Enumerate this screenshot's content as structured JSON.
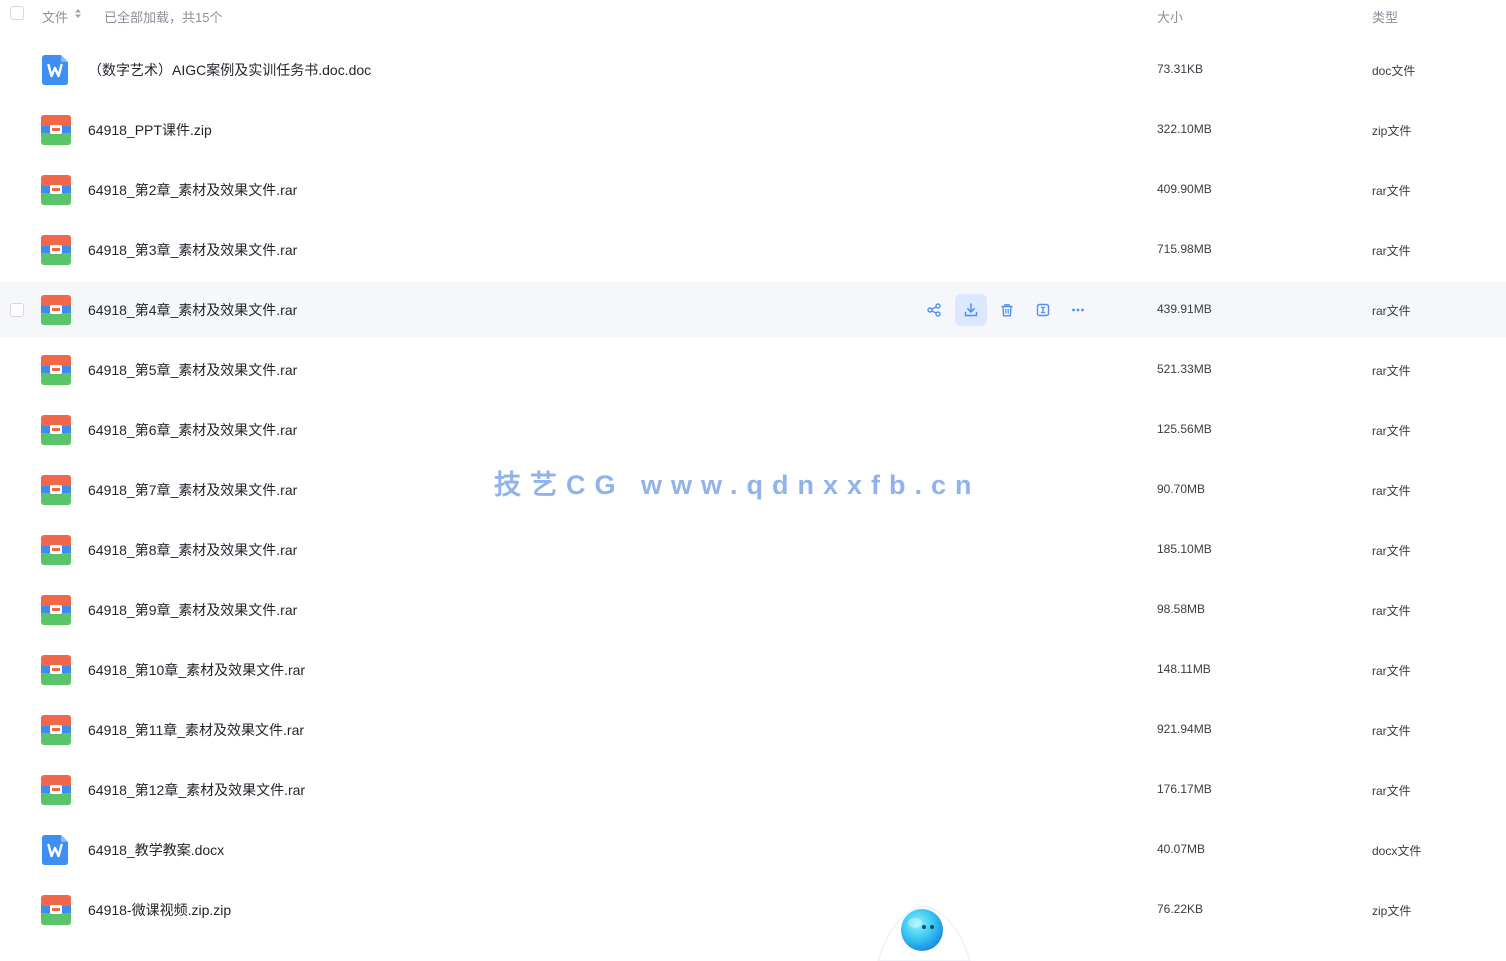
{
  "header": {
    "col_file": "文件",
    "status": "已全部加载，共15个",
    "col_size": "大小",
    "col_type": "类型"
  },
  "files": [
    {
      "name": "（数字艺术）AIGC案例及实训任务书.doc.doc",
      "size": "73.31KB",
      "type": "doc文件",
      "icon": "word-doc-icon"
    },
    {
      "name": "64918_PPT课件.zip",
      "size": "322.10MB",
      "type": "zip文件",
      "icon": "archive-icon"
    },
    {
      "name": "64918_第2章_素材及效果文件.rar",
      "size": "409.90MB",
      "type": "rar文件",
      "icon": "archive-icon"
    },
    {
      "name": "64918_第3章_素材及效果文件.rar",
      "size": "715.98MB",
      "type": "rar文件",
      "icon": "archive-icon"
    },
    {
      "name": "64918_第4章_素材及效果文件.rar",
      "size": "439.91MB",
      "type": "rar文件",
      "icon": "archive-icon"
    },
    {
      "name": "64918_第5章_素材及效果文件.rar",
      "size": "521.33MB",
      "type": "rar文件",
      "icon": "archive-icon"
    },
    {
      "name": "64918_第6章_素材及效果文件.rar",
      "size": "125.56MB",
      "type": "rar文件",
      "icon": "archive-icon"
    },
    {
      "name": "64918_第7章_素材及效果文件.rar",
      "size": "90.70MB",
      "type": "rar文件",
      "icon": "archive-icon"
    },
    {
      "name": "64918_第8章_素材及效果文件.rar",
      "size": "185.10MB",
      "type": "rar文件",
      "icon": "archive-icon"
    },
    {
      "name": "64918_第9章_素材及效果文件.rar",
      "size": "98.58MB",
      "type": "rar文件",
      "icon": "archive-icon"
    },
    {
      "name": "64918_第10章_素材及效果文件.rar",
      "size": "148.11MB",
      "type": "rar文件",
      "icon": "archive-icon"
    },
    {
      "name": "64918_第11章_素材及效果文件.rar",
      "size": "921.94MB",
      "type": "rar文件",
      "icon": "archive-icon"
    },
    {
      "name": "64918_第12章_素材及效果文件.rar",
      "size": "176.17MB",
      "type": "rar文件",
      "icon": "archive-icon"
    },
    {
      "name": "64918_教学教案.docx",
      "size": "40.07MB",
      "type": "docx文件",
      "icon": "word-doc-icon"
    },
    {
      "name": "64918-微课视频.zip.zip",
      "size": "76.22KB",
      "type": "zip文件",
      "icon": "archive-icon"
    }
  ],
  "hover_row": 4,
  "row_actions": [
    "share-icon",
    "download-icon",
    "delete-icon",
    "rename-icon",
    "more-icon"
  ],
  "watermark": "技艺CG www.qdnxxfb.cn",
  "colors": {
    "accent": "#4d8ef7",
    "hover_bg": "#f6f7fa",
    "active_action_bg": "#dbe8ff",
    "archive_top": "#f2664a",
    "archive_stripe": "#3f8cf0",
    "archive_bottom": "#5cc468",
    "word_blue": "#3d8ff2",
    "watermark": "#8fb3ea"
  }
}
